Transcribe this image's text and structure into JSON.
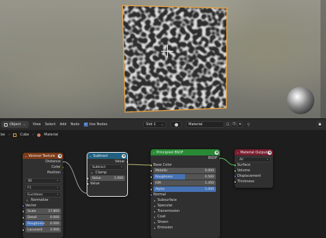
{
  "header": {
    "object_mode": "Object",
    "menus": [
      "View",
      "Select",
      "Add",
      "Node"
    ],
    "use_nodes_label": "Use Nodes",
    "slot": "Slot 1",
    "material": "Material"
  },
  "breadcrumb": [
    "be",
    "Cube",
    "Material"
  ],
  "nodes": {
    "voronoi": {
      "title": "Voronoi Texture",
      "outputs": [
        "Distance",
        "Color",
        "Position"
      ],
      "dimensions": "3D",
      "feature": "F1",
      "metric": "Euclidean",
      "normalize_label": "Normalize",
      "vector_label": "Vector",
      "fields": [
        {
          "label": "Scale",
          "value": "17.800"
        },
        {
          "label": "Detail",
          "value": "0.000"
        },
        {
          "label": "Roughness",
          "value": "0.500",
          "fraction": 0.5
        },
        {
          "label": "Lacunarit",
          "value": "2.000"
        }
      ]
    },
    "subtract": {
      "title": "Subtract",
      "output": "Value",
      "operation": "Subtract",
      "clamp_label": "Clamp",
      "value_label": "Value",
      "value": "1.000",
      "input_label": "Value"
    },
    "bsdf": {
      "title": "Principled BSDF",
      "output": "BSDF",
      "base_color_label": "Base Color",
      "fields": [
        {
          "label": "Metallic",
          "value": "0.000"
        },
        {
          "label": "Roughness",
          "value": "0.500",
          "fraction": 0.5
        },
        {
          "label": "IOR",
          "value": "1.450"
        },
        {
          "label": "Alpha",
          "value": "1.000",
          "fraction": 1.0
        }
      ],
      "normal_label": "Normal",
      "panels": [
        "Subsurface",
        "Specular",
        "Transmission",
        "Coat",
        "Sheen",
        "Emission"
      ]
    },
    "output": {
      "title": "Material Output",
      "target": "All",
      "inputs": [
        "Surface",
        "Volume",
        "Displacement",
        "Thickness"
      ]
    }
  },
  "colors": {
    "texture_header": "#7d3b18",
    "converter_header": "#22607f",
    "shader_header": "#288a35",
    "output_header": "#7a1d2f",
    "selection": "#f0a43a",
    "accent": "#4772b3"
  }
}
